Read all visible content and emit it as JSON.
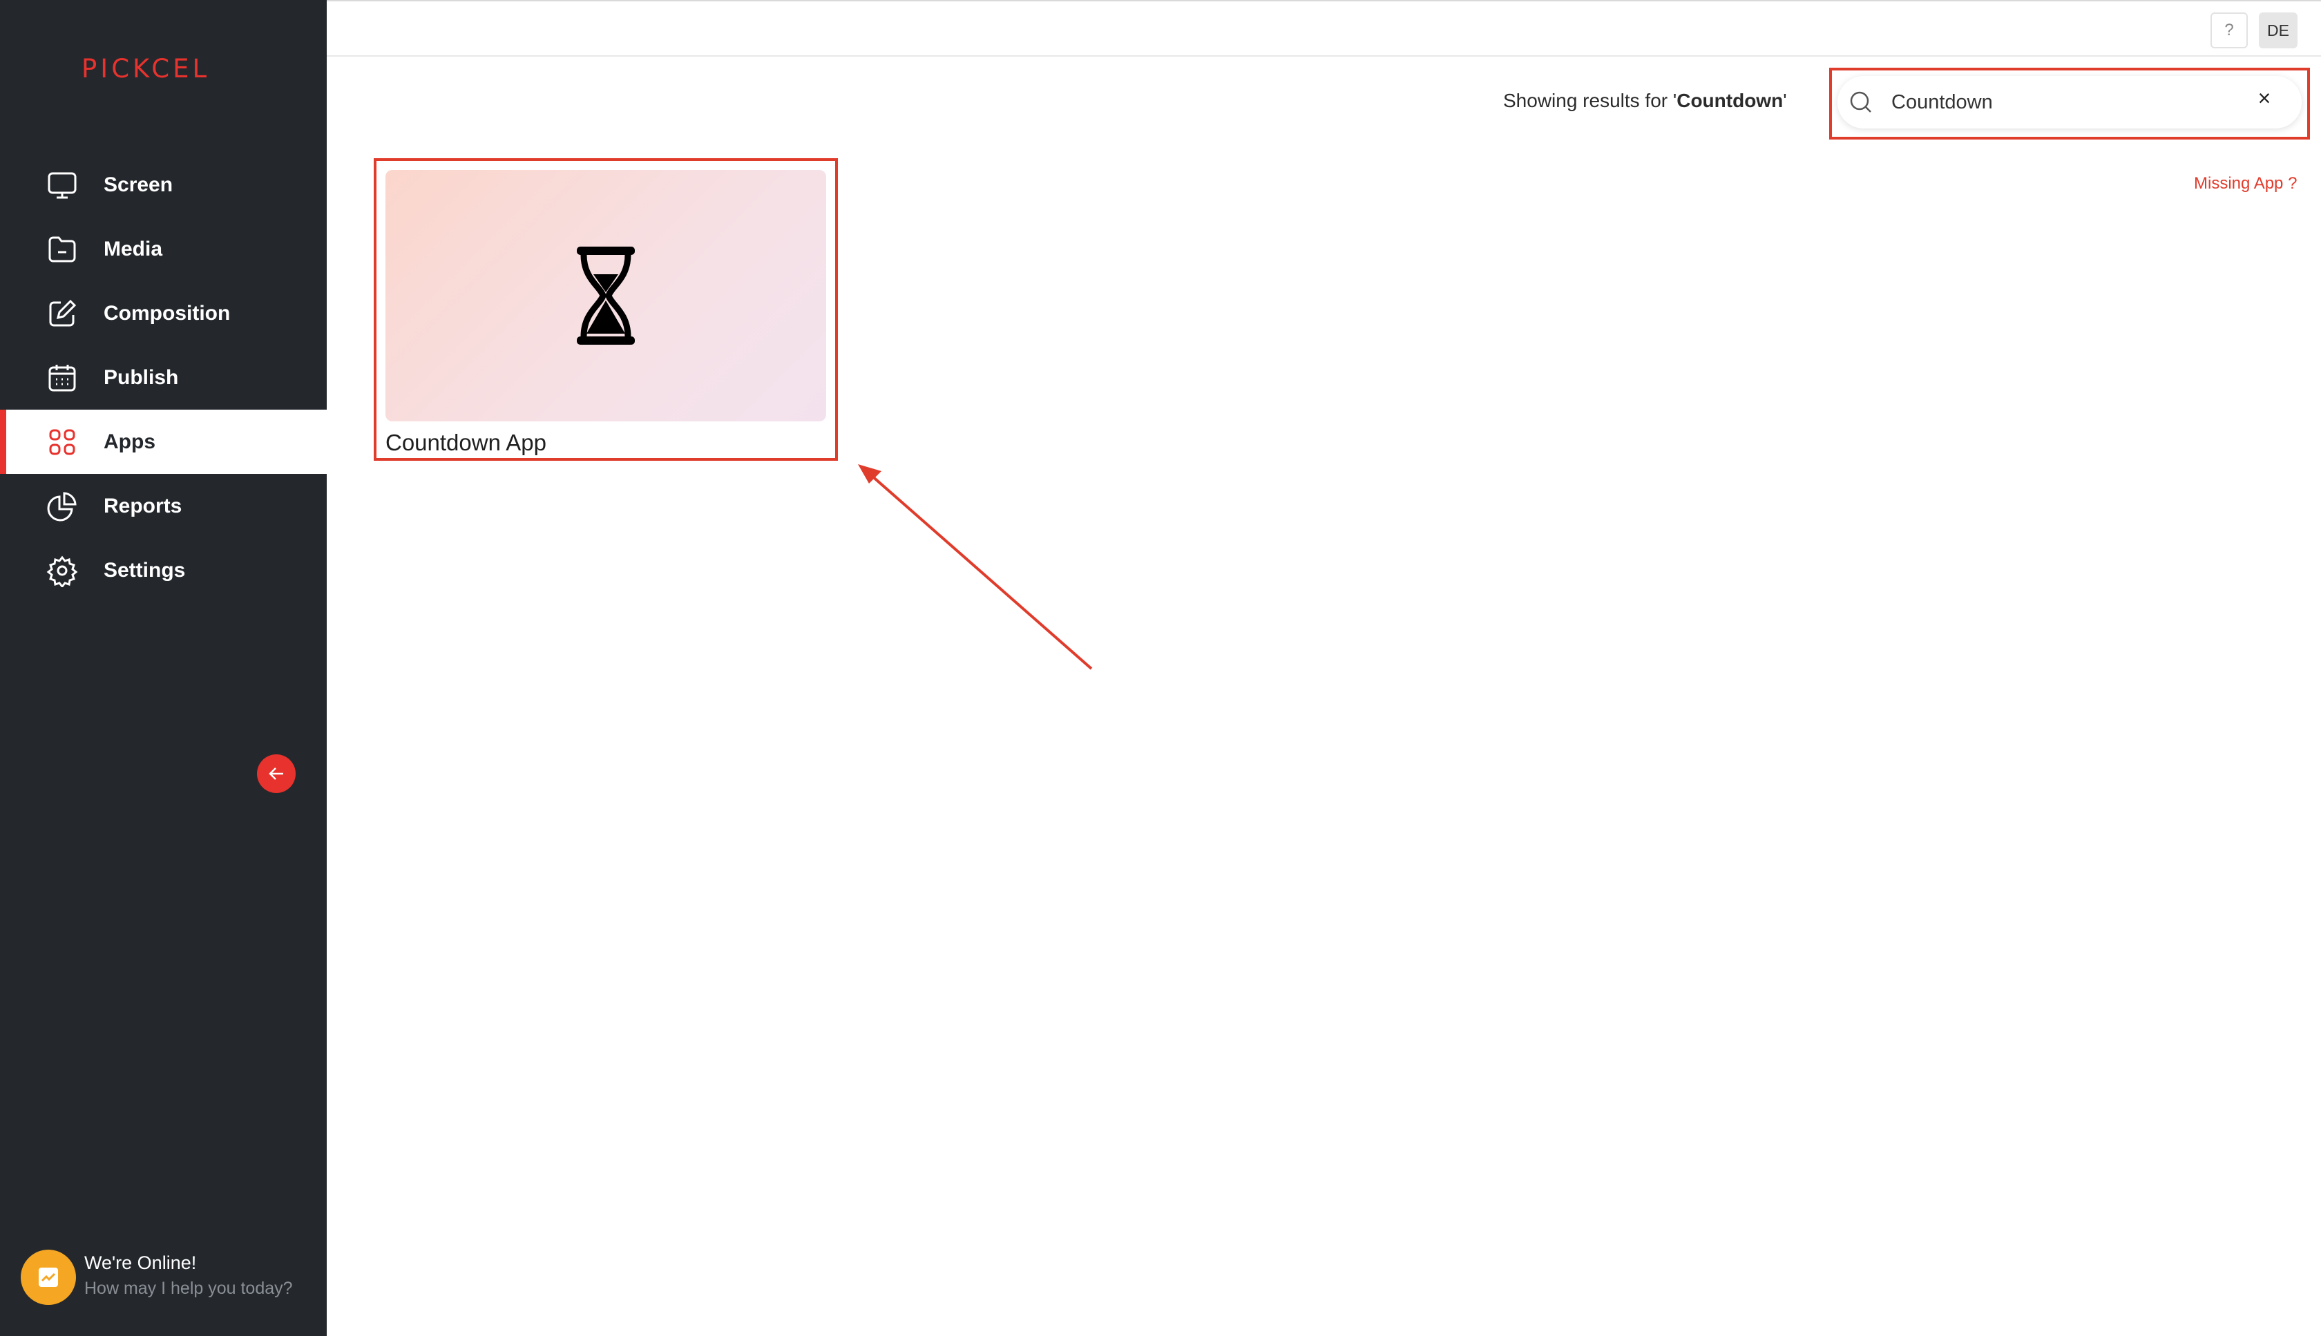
{
  "brand": {
    "logo_text": "PICKCEL",
    "accent_color": "#e8322d"
  },
  "sidebar": {
    "items": [
      {
        "label": "Screen",
        "icon": "monitor-icon",
        "active": false
      },
      {
        "label": "Media",
        "icon": "folder-icon",
        "active": false
      },
      {
        "label": "Composition",
        "icon": "edit-icon",
        "active": false
      },
      {
        "label": "Publish",
        "icon": "calendar-icon",
        "active": false
      },
      {
        "label": "Apps",
        "icon": "apps-grid-icon",
        "active": true
      },
      {
        "label": "Reports",
        "icon": "pie-chart-icon",
        "active": false
      },
      {
        "label": "Settings",
        "icon": "gear-icon",
        "active": false
      }
    ],
    "collapse_icon": "arrow-left-icon",
    "chat": {
      "title": "We're Online!",
      "subtitle": "How may I help you today?"
    }
  },
  "topbar": {
    "help_label": "?",
    "user_initials": "DE"
  },
  "search": {
    "results_prefix": "Showing results for '",
    "results_term": "Countdown",
    "results_suffix": "'",
    "value": "Countdown",
    "clear_label": "×"
  },
  "missing_app_link": "Missing App ?",
  "apps": [
    {
      "name": "Countdown App",
      "icon": "hourglass-icon"
    }
  ]
}
